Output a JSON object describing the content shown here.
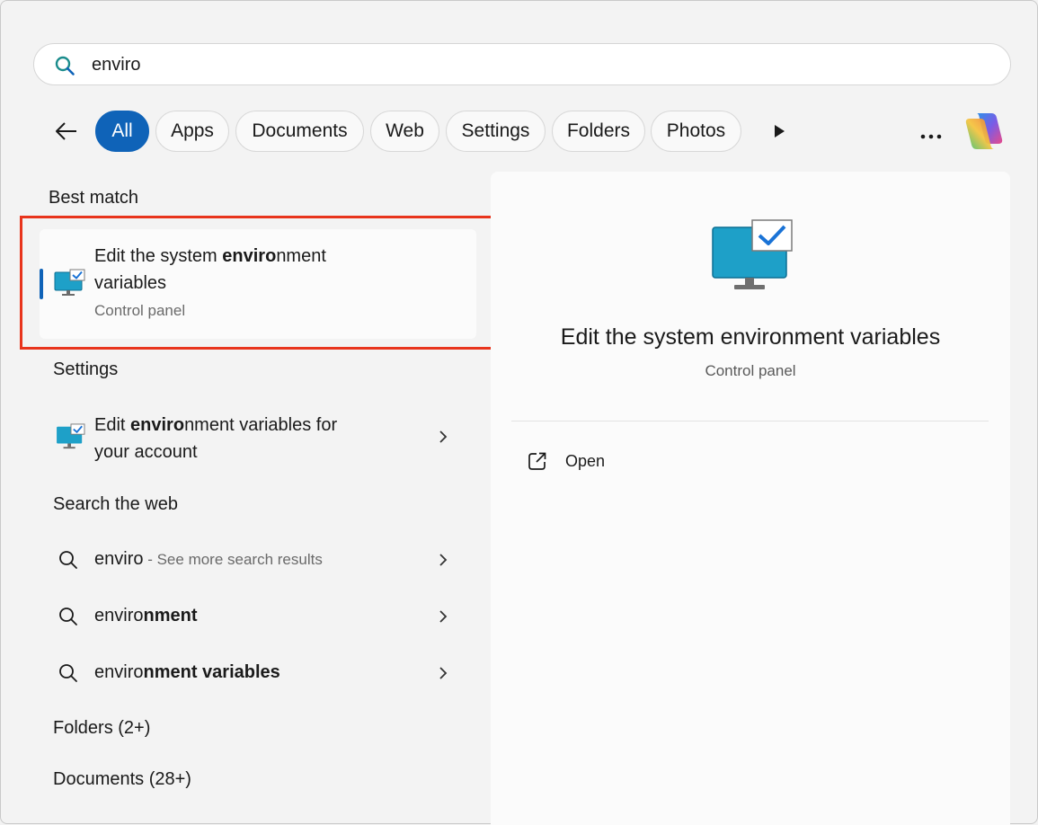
{
  "search": {
    "value": "enviro",
    "placeholder": ""
  },
  "filters": {
    "chips": [
      {
        "label": "All",
        "active": true
      },
      {
        "label": "Apps",
        "active": false
      },
      {
        "label": "Documents",
        "active": false
      },
      {
        "label": "Web",
        "active": false
      },
      {
        "label": "Settings",
        "active": false
      },
      {
        "label": "Folders",
        "active": false
      },
      {
        "label": "Photos",
        "active": false
      }
    ]
  },
  "best_match": {
    "header": "Best match",
    "title_line1_pre": "Edit the system ",
    "title_line1_bold": "enviro",
    "title_line1_post": "nment",
    "title_line2": "variables",
    "subtitle": "Control panel",
    "icon": "monitor-check-icon"
  },
  "settings": {
    "header": "Settings",
    "item_line1_pre": "Edit ",
    "item_line1_bold": "enviro",
    "item_line1_post": "nment variables for",
    "item_line2": "your account",
    "icon": "monitor-check-icon"
  },
  "web": {
    "header": "Search the web",
    "rows": [
      {
        "bold": "enviro",
        "rest": "",
        "hint": " - See more search results"
      },
      {
        "bold": "enviro",
        "rest": "nment",
        "hint": ""
      },
      {
        "bold": "enviro",
        "rest": "nment variables",
        "hint": ""
      }
    ]
  },
  "folders": {
    "header": "Folders (2+)"
  },
  "documents": {
    "header": "Documents (28+)"
  },
  "detail": {
    "title": "Edit the system environment variables",
    "subtitle": "Control panel",
    "open_label": "Open",
    "icon": "monitor-check-icon"
  },
  "colors": {
    "accent": "#0f63b8",
    "highlight": "#e8341c",
    "search_icon": "#1a8c8c"
  }
}
